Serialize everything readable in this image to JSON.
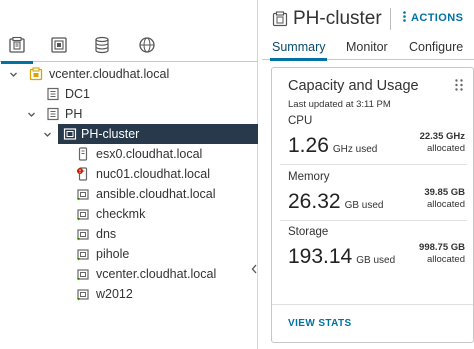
{
  "navigator": {
    "tabs": [
      {
        "icon": "hosts-and-clusters-icon",
        "active": true
      },
      {
        "icon": "vms-and-templates-icon",
        "active": false
      },
      {
        "icon": "storage-icon",
        "active": false
      },
      {
        "icon": "networking-icon",
        "active": false
      }
    ],
    "tree": [
      {
        "label": "vcenter.cloudhat.local",
        "icon": "vcenter-icon"
      },
      {
        "label": "DC1",
        "icon": "datacenter-icon"
      },
      {
        "label": "PH",
        "icon": "datacenter-icon"
      },
      {
        "label": "PH-cluster",
        "icon": "cluster-icon",
        "selected": true
      },
      {
        "label": "esx0.cloudhat.local",
        "icon": "host-icon"
      },
      {
        "label": "nuc01.cloudhat.local",
        "icon": "host-alert-icon"
      },
      {
        "label": "ansible.cloudhat.local",
        "icon": "vm-icon"
      },
      {
        "label": "checkmk",
        "icon": "vm-icon"
      },
      {
        "label": "dns",
        "icon": "vm-icon"
      },
      {
        "label": "pihole",
        "icon": "vm-icon"
      },
      {
        "label": "vcenter.cloudhat.local",
        "icon": "vm-icon"
      },
      {
        "label": "w2012",
        "icon": "vm-icon"
      }
    ]
  },
  "object": {
    "title": "PH-cluster",
    "actions_label": "ACTIONS",
    "tabs": [
      "Summary",
      "Monitor",
      "Configure"
    ],
    "active_tab": "Summary"
  },
  "card": {
    "title": "Capacity and Usage",
    "updated": "Last updated at 3:11 PM",
    "metrics": [
      {
        "label": "CPU",
        "used": "1.26",
        "used_unit": "GHz used",
        "allocated": "22.35 GHz",
        "allocated_label": "allocated"
      },
      {
        "label": "Memory",
        "used": "26.32",
        "used_unit": "GB used",
        "allocated": "39.85 GB",
        "allocated_label": "allocated"
      },
      {
        "label": "Storage",
        "used": "193.14",
        "used_unit": "GB used",
        "allocated": "998.75 GB",
        "allocated_label": "allocated"
      }
    ],
    "footer_link": "VIEW STATS"
  },
  "colors": {
    "accent": "#0072a3",
    "selected_row": "#27394a",
    "vcenter_icon": "#d8a400",
    "alert": "#c21d00",
    "vm_green": "#3c8500"
  }
}
